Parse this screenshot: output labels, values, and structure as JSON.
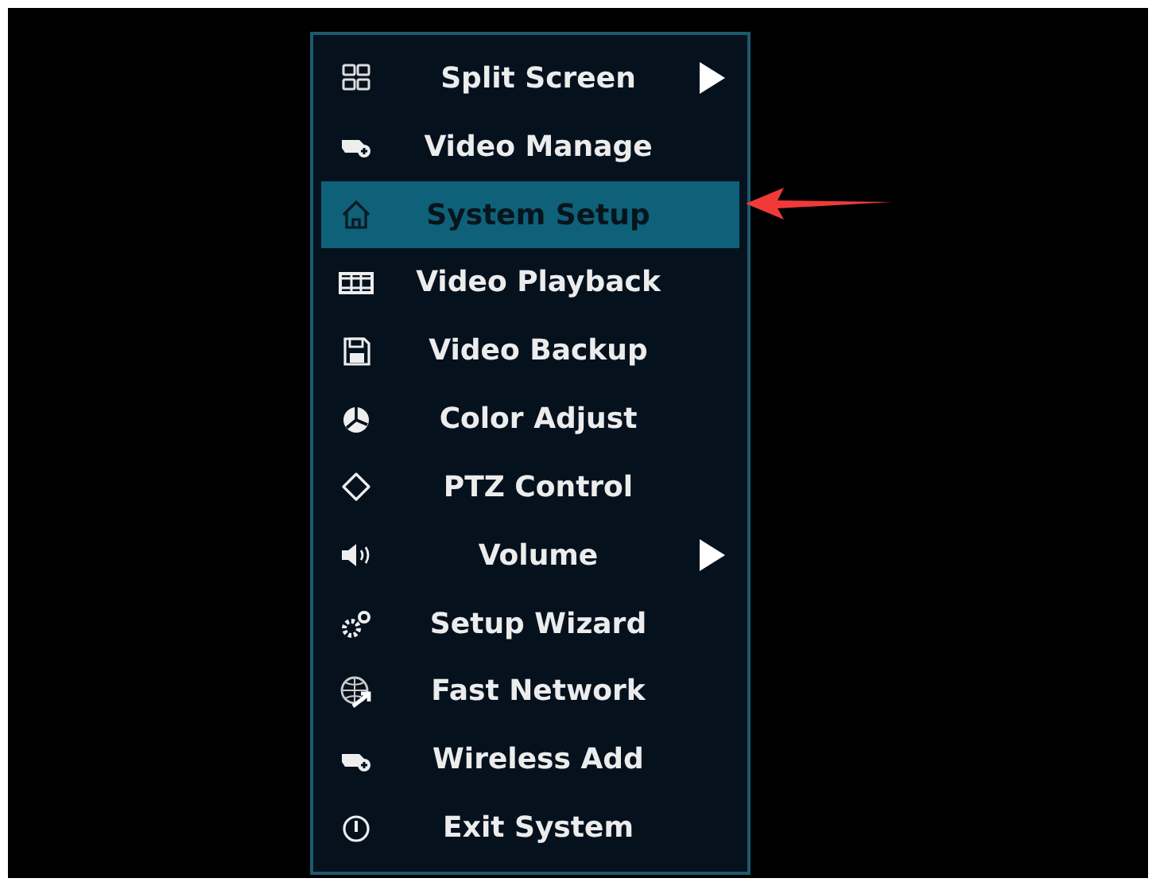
{
  "menu": {
    "items": [
      {
        "label": "Split Screen",
        "kind": "grid",
        "submenu": true,
        "selected": false
      },
      {
        "label": "Video Manage",
        "kind": "camera",
        "submenu": false,
        "selected": false
      },
      {
        "label": "System Setup",
        "kind": "home",
        "submenu": false,
        "selected": true
      },
      {
        "label": "Video Playback",
        "kind": "film",
        "submenu": false,
        "selected": false
      },
      {
        "label": "Video Backup",
        "kind": "floppy",
        "submenu": false,
        "selected": false
      },
      {
        "label": "Color Adjust",
        "kind": "palette",
        "submenu": false,
        "selected": false
      },
      {
        "label": "PTZ Control",
        "kind": "ptz",
        "submenu": false,
        "selected": false
      },
      {
        "label": "Volume",
        "kind": "speaker",
        "submenu": true,
        "selected": false
      },
      {
        "label": "Setup Wizard",
        "kind": "gears",
        "submenu": false,
        "selected": false
      },
      {
        "label": "Fast Network",
        "kind": "globe",
        "submenu": false,
        "selected": false
      },
      {
        "label": "Wireless Add",
        "kind": "camera",
        "submenu": false,
        "selected": false
      },
      {
        "label": "Exit System",
        "kind": "power",
        "submenu": false,
        "selected": false
      }
    ]
  }
}
